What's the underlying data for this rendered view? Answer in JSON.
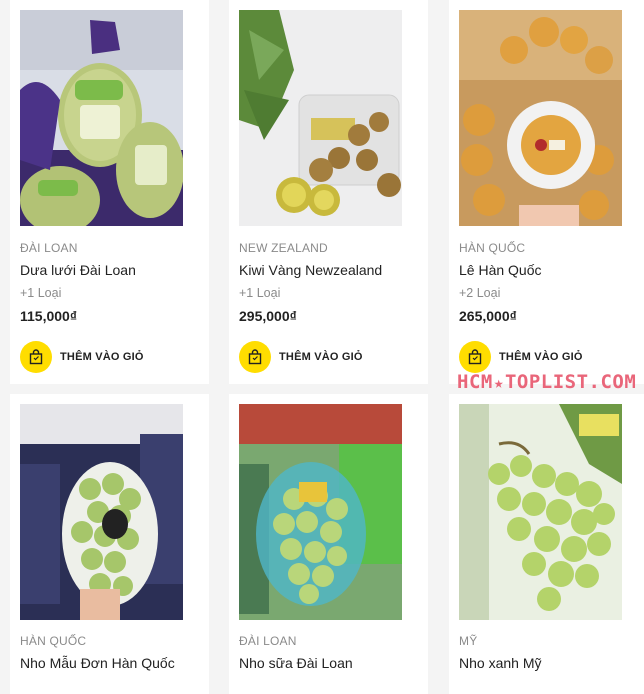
{
  "products": [
    {
      "origin": "ĐÀI LOAN",
      "name": "Dưa lưới Đài Loan",
      "variants": "+1 Loại",
      "price": "115,000₫",
      "add_to_cart": "THÊM VÀO GIỎ",
      "image_icon": "melon-photo"
    },
    {
      "origin": "NEW ZEALAND",
      "name": "Kiwi Vàng Newzealand",
      "variants": "+1 Loại",
      "price": "295,000₫",
      "add_to_cart": "THÊM VÀO GIỎ",
      "image_icon": "kiwi-photo"
    },
    {
      "origin": "HÀN QUỐC",
      "name": "Lê Hàn Quốc",
      "variants": "+2 Loại",
      "price": "265,000₫",
      "add_to_cart": "THÊM VÀO GIỎ",
      "image_icon": "pear-photo"
    },
    {
      "origin": "HÀN QUỐC",
      "name": "Nho Mẫu Đơn Hàn Quốc",
      "image_icon": "grape-box-photo"
    },
    {
      "origin": "ĐÀI LOAN",
      "name": "Nho sữa Đài Loan",
      "image_icon": "grape-tray-photo"
    },
    {
      "origin": "MỸ",
      "name": "Nho xanh Mỹ",
      "image_icon": "grape-bag-photo"
    }
  ],
  "watermark": {
    "part1": "HCM",
    "part2": "TOPLIST.COM"
  },
  "colors": {
    "accent": "#ffdd00",
    "text": "#222222",
    "muted": "#8a8a8a"
  }
}
